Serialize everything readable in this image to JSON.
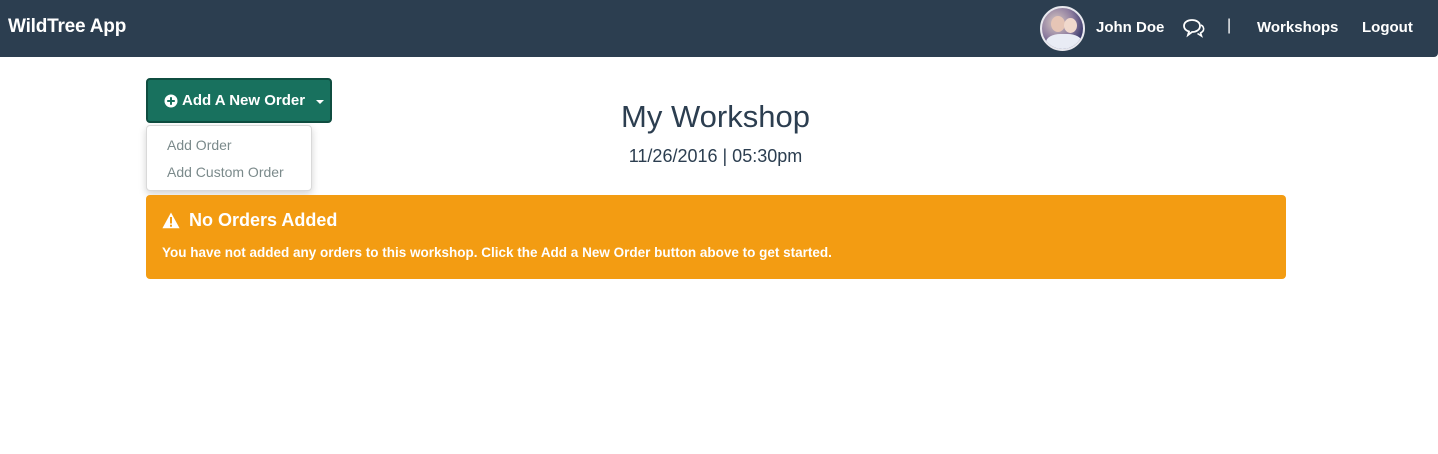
{
  "navbar": {
    "brand": "WildTree App",
    "user_name": "John Doe",
    "separator": "|",
    "workshops_link": "Workshops",
    "logout_link": "Logout",
    "background_color": "#2c3e50"
  },
  "actions": {
    "add_order_button": "Add A New Order",
    "menu": {
      "add_order": "Add Order",
      "add_custom_order": "Add Custom Order"
    },
    "button_color": "#18715e"
  },
  "workshop": {
    "title": "My Workshop",
    "date_time": "11/26/2016 | 05:30pm"
  },
  "alert": {
    "title": "No Orders Added",
    "message_before": "You have not added any orders to this workshop. Click the ",
    "message_emphasis": "Add a New Order",
    "message_after": " button above to get started.",
    "color": "#f39c12"
  }
}
